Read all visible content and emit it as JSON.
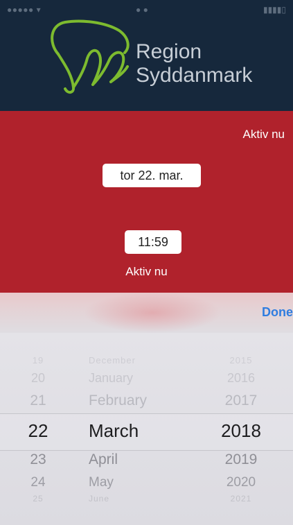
{
  "header": {
    "brand_line1": "Region",
    "brand_line2": "Syddanmark",
    "logo_icon": "region-syddanmark-logo-icon",
    "logo_color": "#7dbb2f",
    "background": "#16283c"
  },
  "panel": {
    "background": "#b0222c",
    "status_top": "Aktiv nu",
    "date_value": "tor 22. mar.",
    "time_value": "11:59",
    "status_bottom": "Aktiv nu"
  },
  "picker": {
    "done_label": "Done",
    "done_color": "#2f7de0",
    "days": [
      "19",
      "20",
      "21",
      "22",
      "23",
      "24",
      "25"
    ],
    "months": [
      "December",
      "January",
      "February",
      "March",
      "April",
      "May",
      "June"
    ],
    "years": [
      "2015",
      "2016",
      "2017",
      "2018",
      "2019",
      "2020",
      "2021"
    ],
    "selected": {
      "day": "22",
      "month": "March",
      "year": "2018"
    }
  }
}
